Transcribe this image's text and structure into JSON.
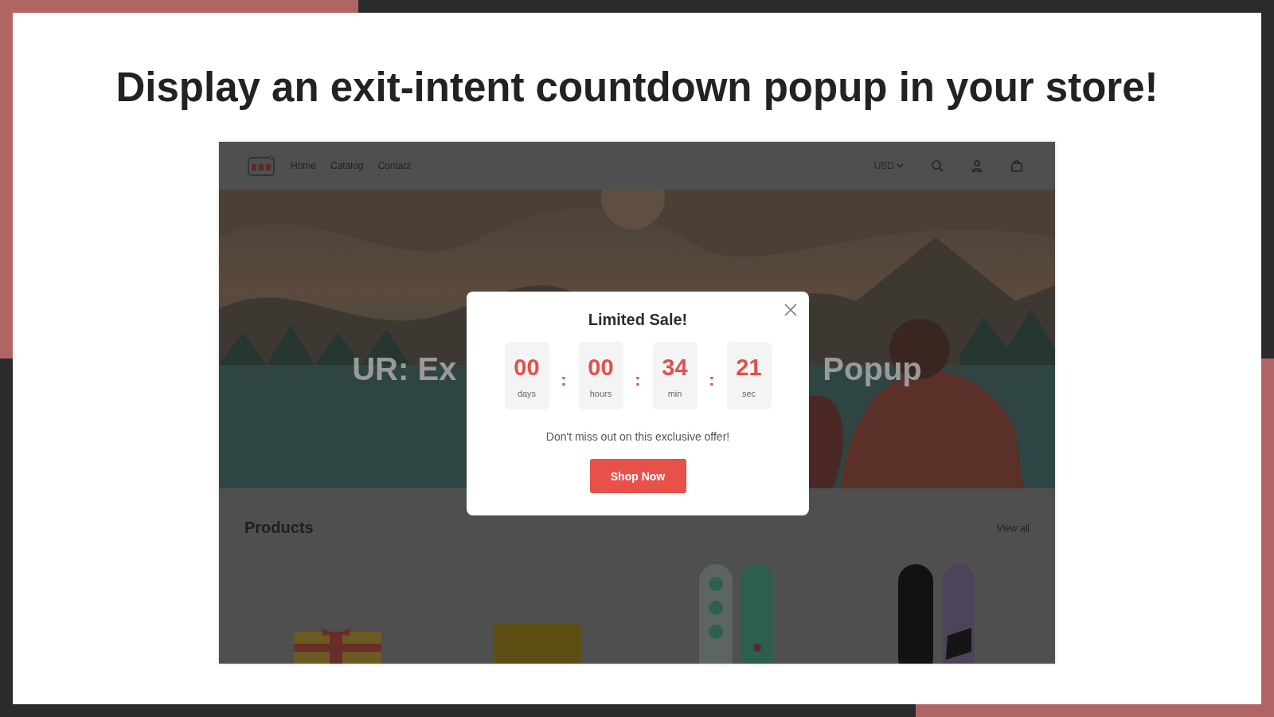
{
  "headline": "Display an exit-intent countdown popup in your store!",
  "store": {
    "nav": [
      "Home",
      "Catalog",
      "Contact"
    ],
    "currency": "USD",
    "hero_text": [
      "UR: Ex",
      "Popup"
    ],
    "section_title": "Products",
    "view_all": "View all"
  },
  "popup": {
    "title": "Limited Sale!",
    "units": [
      {
        "value": "00",
        "label": "days"
      },
      {
        "value": "00",
        "label": "hours"
      },
      {
        "value": "34",
        "label": "min"
      },
      {
        "value": "21",
        "label": "sec"
      }
    ],
    "separator": ":",
    "message": "Don't miss out on this exclusive offer!",
    "button": "Shop Now"
  }
}
